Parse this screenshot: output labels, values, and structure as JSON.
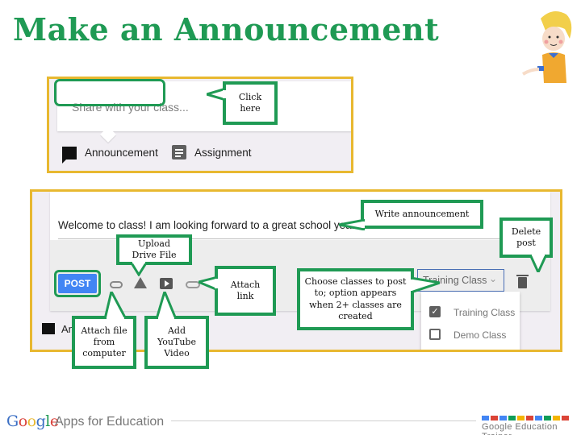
{
  "slide": {
    "title": "Make an Announcement",
    "title_color": "#1f9a54",
    "mascot_icon": "teacher-illustration"
  },
  "panel1": {
    "share_placeholder": "Share with your class...",
    "tabs": [
      {
        "label": "Announcement",
        "icon": "speech-bubble-icon",
        "highlighted": true
      },
      {
        "label": "Assignment",
        "icon": "assignment-icon",
        "highlighted": false
      }
    ],
    "callout_click_here": "Click here"
  },
  "panel2": {
    "compose_text": "Welcome to class! I am looking forward to a great school year.",
    "post_button": "POST",
    "tools": [
      {
        "name": "attach-file",
        "icon": "paperclip-icon"
      },
      {
        "name": "google-drive",
        "icon": "drive-icon"
      },
      {
        "name": "youtube",
        "icon": "youtube-icon"
      },
      {
        "name": "link",
        "icon": "link-icon"
      }
    ],
    "class_select": {
      "selected": "Training Class",
      "options": [
        {
          "label": "Training Class",
          "checked": true
        },
        {
          "label": "Demo Class",
          "checked": false
        }
      ]
    },
    "delete_icon": "trash-icon",
    "bottom_tab_label": "Ann"
  },
  "callouts": {
    "write_announcement": "Write announcement",
    "delete_post": "Delete post",
    "upload_drive": "Upload Drive File",
    "attach_link": "Attach link",
    "choose_classes": "Choose classes to post to; option appears when 2+ classes are created",
    "attach_file": "Attach file from computer",
    "add_youtube": "Add YouTube Video"
  },
  "footer": {
    "google": "Google",
    "google_colors": [
      "#3b6fc4",
      "#d9413a",
      "#e8b830",
      "#3b6fc4",
      "#1f9a54",
      "#d9413a"
    ],
    "apps_label": "Apps for Education",
    "trainer_label": "Google Education Trainer",
    "square_colors": [
      "#4285f4",
      "#db4437",
      "#4285f4",
      "#0f9d58",
      "#f4b400",
      "#db4437",
      "#4285f4",
      "#0f9d58",
      "#f4b400",
      "#db4437"
    ]
  }
}
